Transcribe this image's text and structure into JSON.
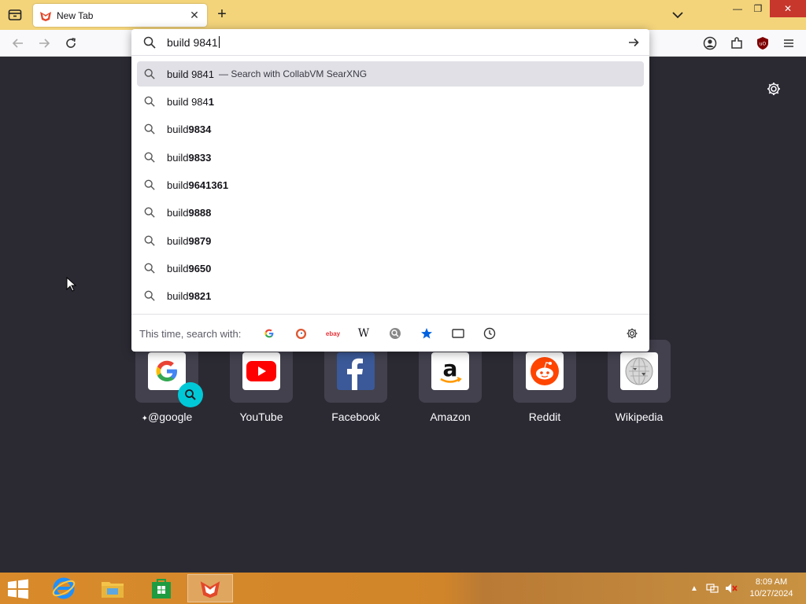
{
  "browser": {
    "tab_title": "New Tab",
    "tab_close": "✕",
    "new_tab": "+"
  },
  "window_controls": {
    "minimize": "—",
    "maximize": "❐",
    "close": "✕"
  },
  "urlbar": {
    "value": "build 9841",
    "results": [
      {
        "prefix": "build 9841",
        "bold": "",
        "action": "— Search with CollabVM SearXNG"
      },
      {
        "prefix": "build 984",
        "bold": "1",
        "action": ""
      },
      {
        "prefix": "build ",
        "bold": "9834",
        "action": ""
      },
      {
        "prefix": "build ",
        "bold": "9833",
        "action": ""
      },
      {
        "prefix": "build ",
        "bold": "9641361",
        "action": ""
      },
      {
        "prefix": "build ",
        "bold": "9888",
        "action": ""
      },
      {
        "prefix": "build ",
        "bold": "9879",
        "action": ""
      },
      {
        "prefix": "build ",
        "bold": "9650",
        "action": ""
      },
      {
        "prefix": "build ",
        "bold": "9821",
        "action": ""
      }
    ],
    "search_with_label": "This time, search with:",
    "engines": [
      "google-icon",
      "duckduckgo-icon",
      "ebay-icon",
      "wikipedia-icon",
      "searxng-icon",
      "bookmarks-icon",
      "tabs-icon",
      "history-icon"
    ],
    "ebay_text": "ebay",
    "wiki_text": "W"
  },
  "shortcuts": [
    {
      "label": "@google",
      "pin": "✦"
    },
    {
      "label": "YouTube"
    },
    {
      "label": "Facebook"
    },
    {
      "label": "Amazon"
    },
    {
      "label": "Reddit"
    },
    {
      "label": "Wikipedia"
    }
  ],
  "taskbar": {
    "time": "8:09 AM",
    "date": "10/27/2024"
  },
  "colors": {
    "tabbar": "#f3d47b",
    "content_bg": "#2b2a33",
    "tile_bg": "#42414d",
    "accent": "#00c8d7",
    "taskbar": "#d98b2b"
  }
}
